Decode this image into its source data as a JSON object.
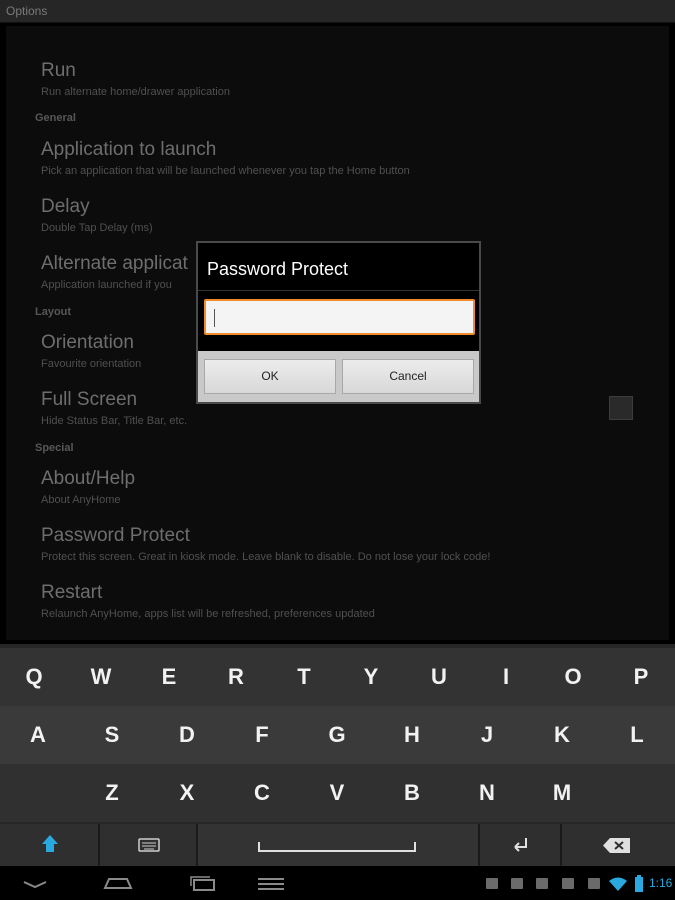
{
  "titlebar": {
    "title": "Options"
  },
  "prefs": {
    "run": {
      "title": "Run",
      "summary": "Run alternate home/drawer application"
    },
    "cat_general": "General",
    "app_launch": {
      "title": "Application to launch",
      "summary": "Pick an application that will be launched whenever you tap the Home button"
    },
    "delay": {
      "title": "Delay",
      "summary": "Double Tap Delay (ms)"
    },
    "alt_app": {
      "title": "Alternate applicat",
      "summary": "Application launched if you"
    },
    "cat_layout": "Layout",
    "orientation": {
      "title": "Orientation",
      "summary": "Favourite orientation"
    },
    "fullscreen": {
      "title": "Full Screen",
      "summary": "Hide Status Bar, Title Bar, etc."
    },
    "cat_special": "Special",
    "about": {
      "title": "About/Help",
      "summary": "About AnyHome"
    },
    "password": {
      "title": "Password Protect",
      "summary": "Protect this screen. Great in kiosk mode. Leave blank to disable. Do not lose your lock code!"
    },
    "restart": {
      "title": "Restart",
      "summary": "Relaunch AnyHome, apps list will be refreshed, preferences updated"
    }
  },
  "dialog": {
    "title": "Password Protect",
    "input_value": "",
    "ok_label": "OK",
    "cancel_label": "Cancel"
  },
  "keyboard": {
    "row1": [
      "Q",
      "W",
      "E",
      "R",
      "T",
      "Y",
      "U",
      "I",
      "O",
      "P"
    ],
    "row2": [
      "A",
      "S",
      "D",
      "F",
      "G",
      "H",
      "J",
      "K",
      "L"
    ],
    "row3": [
      "Z",
      "X",
      "C",
      "V",
      "B",
      "N",
      "M"
    ]
  },
  "status": {
    "time": "1:16"
  },
  "colors": {
    "accent": "#f08b2a",
    "status_blue": "#29a9e0"
  }
}
